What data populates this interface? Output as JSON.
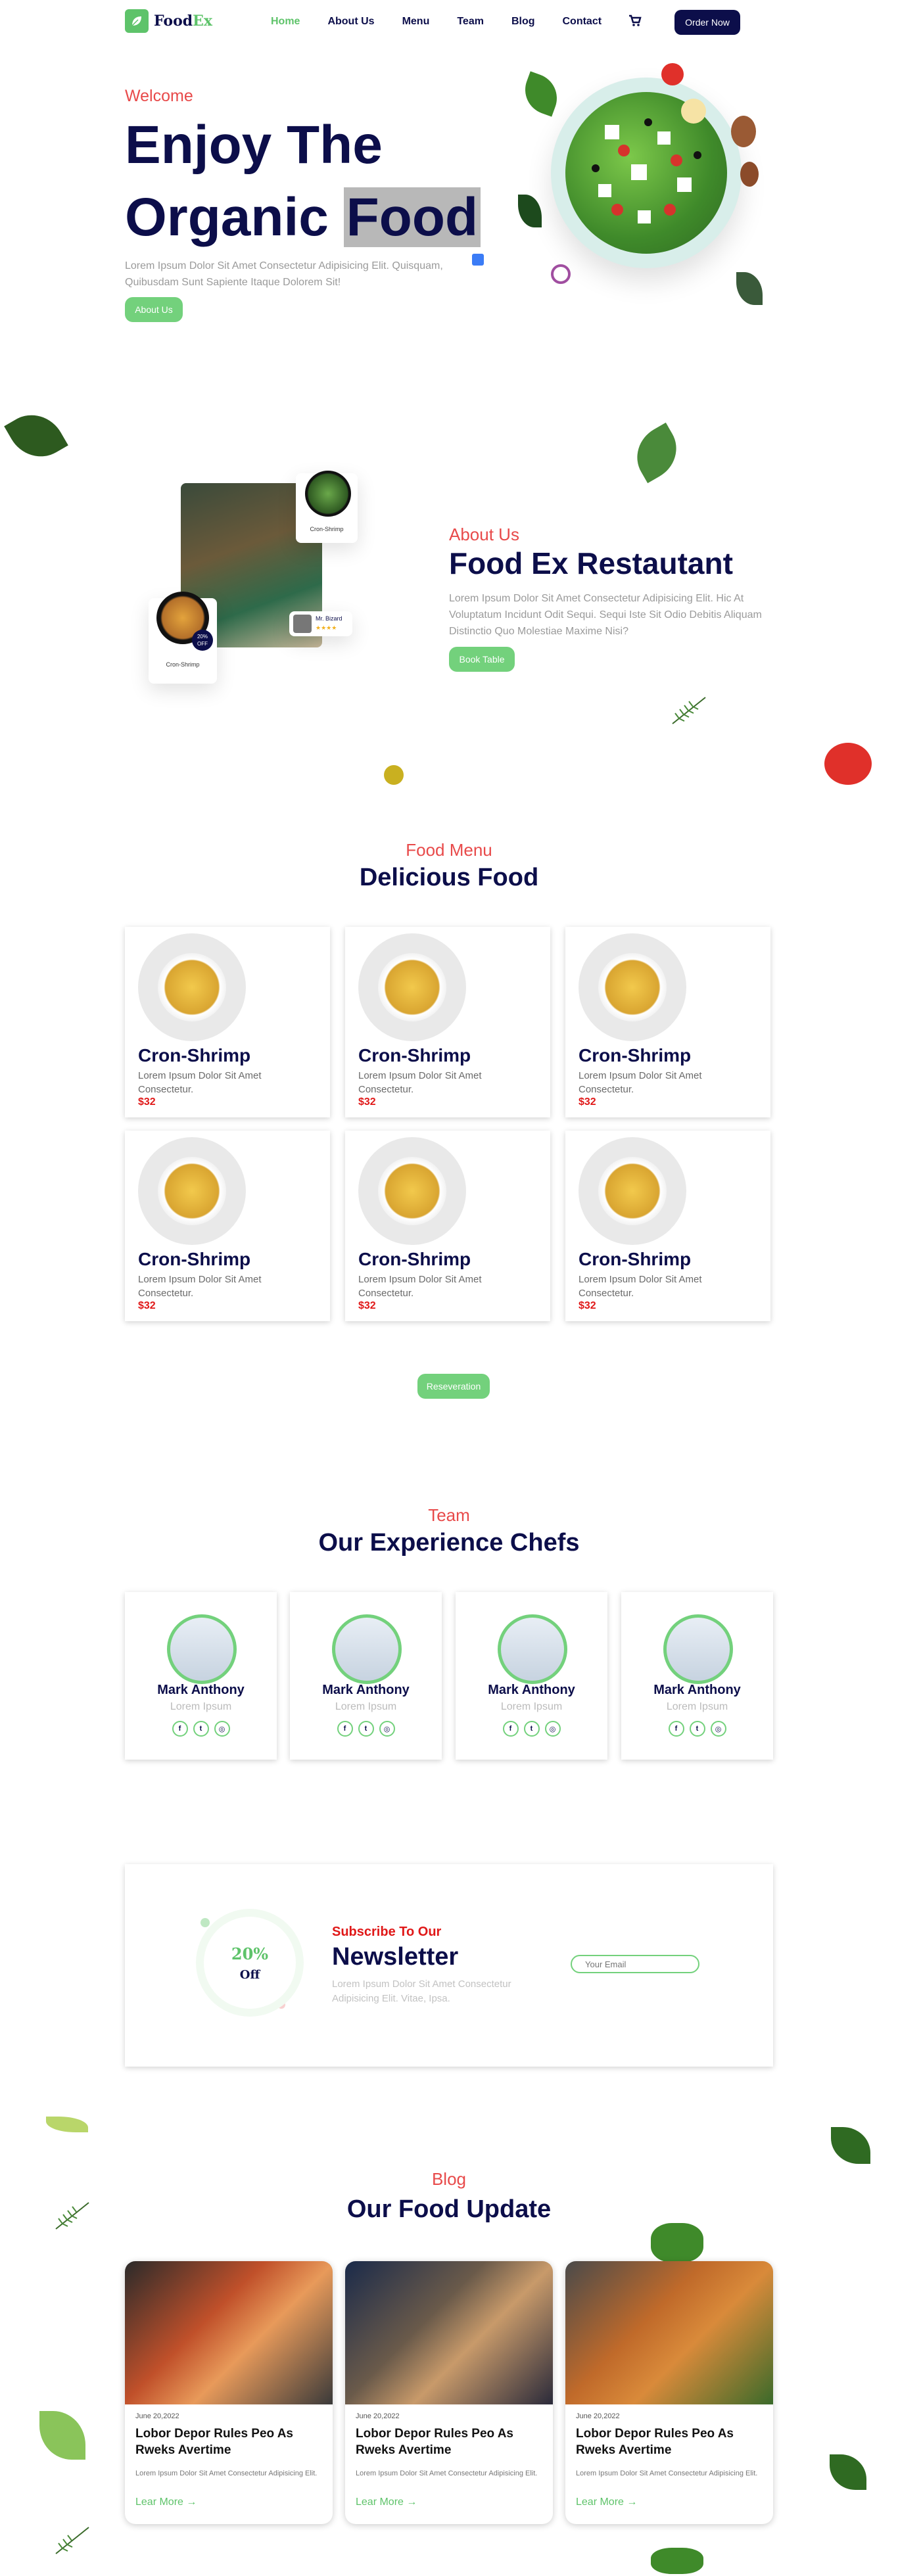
{
  "nav": {
    "logo": {
      "brand": "Food",
      "suffix": "Ex"
    },
    "items": [
      {
        "label": "Home",
        "active": true
      },
      {
        "label": "About Us",
        "active": false
      },
      {
        "label": "Menu",
        "active": false
      },
      {
        "label": "Team",
        "active": false
      },
      {
        "label": "Blog",
        "active": false
      },
      {
        "label": "Contact",
        "active": false
      }
    ],
    "cart_icon": "cart-icon",
    "order_label": "Order Now"
  },
  "hero": {
    "welcome": "Welcome",
    "title_line1": "Enjoy The",
    "title_line2_a": "Organic",
    "title_line2_b": "Food",
    "text": "Lorem Ipsum Dolor Sit Amet Consectetur Adipisicing Elit. Quisquam, Quibusdam Sunt Sapiente Itaque Dolorem Sit!",
    "button": "About Us"
  },
  "about": {
    "label": "About Us",
    "title": "Food Ex Restautant",
    "text": "Lorem Ipsum Dolor Sit Amet Consectetur Adipisicing Elit. Hic At Voluptatum Incidunt Odit Sequi. Sequi Iste Sit Odio Debitis Aliquam Distinctio Quo Molestiae Maxime Nisi?",
    "button": "Book Table",
    "card_top_label": "Cron-Shrimp",
    "card_bottom_label": "Cron-Shrimp",
    "reviewer": "Mr. Bizard",
    "stars": "★★★★",
    "badge_pct": "20%",
    "badge_off": "OFF"
  },
  "menu": {
    "label": "Food Menu",
    "title": "Delicious Food",
    "items": [
      {
        "name": "Cron-Shrimp",
        "desc": "Lorem Ipsum Dolor Sit Amet Consectetur.",
        "price": "$32"
      },
      {
        "name": "Cron-Shrimp",
        "desc": "Lorem Ipsum Dolor Sit Amet Consectetur.",
        "price": "$32"
      },
      {
        "name": "Cron-Shrimp",
        "desc": "Lorem Ipsum Dolor Sit Amet Consectetur.",
        "price": "$32"
      },
      {
        "name": "Cron-Shrimp",
        "desc": "Lorem Ipsum Dolor Sit Amet Consectetur.",
        "price": "$32"
      },
      {
        "name": "Cron-Shrimp",
        "desc": "Lorem Ipsum Dolor Sit Amet Consectetur.",
        "price": "$32"
      },
      {
        "name": "Cron-Shrimp",
        "desc": "Lorem Ipsum Dolor Sit Amet Consectetur.",
        "price": "$32"
      }
    ],
    "button": "Reseveration"
  },
  "team": {
    "label": "Team",
    "title": "Our Experience Chefs",
    "chefs": [
      {
        "name": "Mark Anthony",
        "role": "Lorem Ipsum"
      },
      {
        "name": "Mark Anthony",
        "role": "Lorem Ipsum"
      },
      {
        "name": "Mark Anthony",
        "role": "Lorem Ipsum"
      },
      {
        "name": "Mark Anthony",
        "role": "Lorem Ipsum"
      }
    ],
    "social_icons": [
      "facebook-icon",
      "twitter-icon",
      "instagram-icon"
    ]
  },
  "newsletter": {
    "discount": "20%",
    "off": "Off",
    "subtitle": "Subscribe To Our",
    "title": "Newsletter",
    "text": "Lorem Ipsum Dolor Sit Amet Consectetur Adipisicing Elit. Vitae, Ipsa.",
    "placeholder": "Your Email"
  },
  "blog": {
    "label": "Blog",
    "title": "Our Food Update",
    "posts": [
      {
        "date": "June 20,2022",
        "title": "Lobor Depor Rules Peo As Rweks Avertime",
        "desc": "Lorem Ipsum Dolor Sit Amet Consectetur Adipisicing Elit.",
        "more": "Lear More"
      },
      {
        "date": "June 20,2022",
        "title": "Lobor Depor Rules Peo As Rweks Avertime",
        "desc": "Lorem Ipsum Dolor Sit Amet Consectetur Adipisicing Elit.",
        "more": "Lear More"
      },
      {
        "date": "June 20,2022",
        "title": "Lobor Depor Rules Peo As Rweks Avertime",
        "desc": "Lorem Ipsum Dolor Sit Amet Consectetur Adipisicing Elit.",
        "more": "Lear More"
      }
    ]
  },
  "colors": {
    "navy": "#0c0e4a",
    "green": "#73d17c",
    "red": "#e84a4a",
    "price": "#e01818"
  }
}
